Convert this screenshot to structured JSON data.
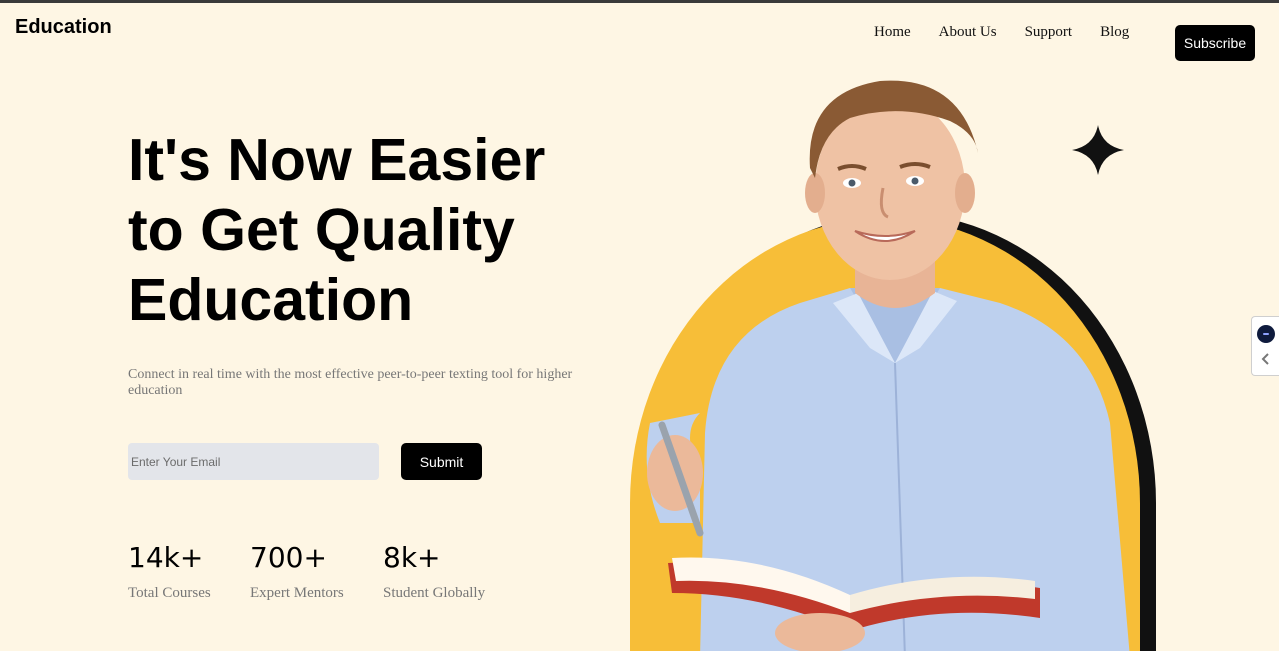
{
  "header": {
    "brand": "Education",
    "nav": [
      "Home",
      "About Us",
      "Support",
      "Blog"
    ],
    "subscribe_label": "Subscribe"
  },
  "hero": {
    "title_lines": [
      "It's Now Easier",
      "to Get Quality",
      "Education"
    ],
    "subtitle": "Connect in real time with the most effective peer-to-peer texting tool for higher education",
    "email_placeholder": "Enter Your Email",
    "submit_label": "Submit"
  },
  "stats": [
    {
      "value": "14k+",
      "label": "Total Courses"
    },
    {
      "value": "700+",
      "label": "Expert Mentors"
    },
    {
      "value": "8k+",
      "label": "Student Globally"
    }
  ],
  "colors": {
    "background": "#FEF6E4",
    "accent_arch": "#F7BE38",
    "button": "#000000",
    "input_bg": "#E3E5EA",
    "muted_text": "#777777"
  },
  "icons": {
    "sparkle": "four-point-star-icon",
    "widget": "chat-widget-icon",
    "collapse": "chevron-left-icon"
  }
}
